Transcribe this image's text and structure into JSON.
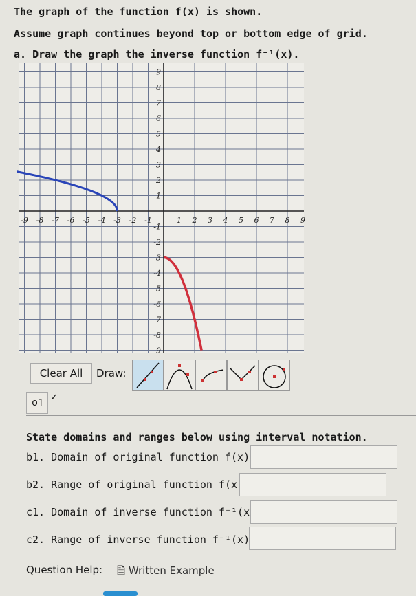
{
  "problem": {
    "line1": "The graph of the function f(x) is shown.",
    "line2": "Assume graph continues beyond top or bottom edge of grid.",
    "part_a": "a. Draw the graph the inverse function f⁻¹(x)."
  },
  "graph": {
    "x_ticks": [
      "-9",
      "-8",
      "-7",
      "-6",
      "-5",
      "-4",
      "-3",
      "-2",
      "-1",
      "1",
      "2",
      "3",
      "4",
      "5",
      "6",
      "7",
      "8",
      "9"
    ],
    "y_ticks": [
      "9",
      "8",
      "7",
      "6",
      "5",
      "4",
      "3",
      "2",
      "1",
      "-1",
      "-2",
      "-3",
      "-4",
      "-5",
      "-6",
      "-7",
      "-8",
      "-9"
    ],
    "xlim": [
      -9,
      9
    ],
    "ylim": [
      -9,
      9
    ],
    "grid": true,
    "original_curve": {
      "color": "#2a45b8",
      "description_points": [
        [
          -3,
          0
        ],
        [
          -4,
          1
        ],
        [
          -7,
          2
        ],
        [
          -9.5,
          2.55
        ]
      ]
    },
    "drawn_curve": {
      "color": "#d0303c",
      "points": [
        [
          0,
          -3
        ],
        [
          1,
          -4
        ],
        [
          2,
          -7
        ],
        [
          2.45,
          -9
        ]
      ]
    }
  },
  "toolbar": {
    "clear_all": "Clear All",
    "draw_label": "Draw:",
    "tools": [
      "line",
      "parabola",
      "sqrt",
      "absolute-value",
      "circle"
    ],
    "selected_tool": "line"
  },
  "state_prompt": "State domains and ranges below using interval notation.",
  "questions": [
    {
      "label": "b1. Domain of original function f(x):",
      "value": ""
    },
    {
      "label": "b2. Range of original function f(x):",
      "value": ""
    },
    {
      "label": "c1. Domain of inverse function f⁻¹(x):",
      "value": ""
    },
    {
      "label": "c2. Range of inverse function f⁻¹(x):",
      "value": ""
    }
  ],
  "help": {
    "label": "Question Help:",
    "link": "Written Example"
  }
}
